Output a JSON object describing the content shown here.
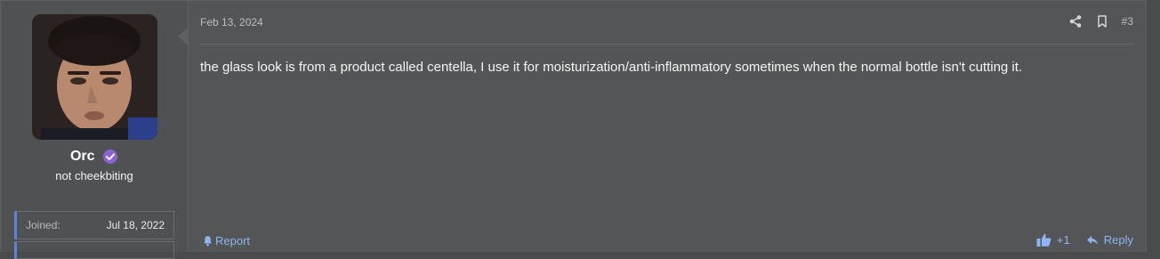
{
  "user": {
    "name": "Orc",
    "title": "not cheekbiting",
    "stats": [
      {
        "label": "Joined:",
        "value": "Jul 18, 2022"
      }
    ]
  },
  "post": {
    "date": "Feb 13, 2024",
    "number": "#3",
    "content": "the glass look is from a product called centella, I use it for moisturization/anti-inflammatory sometimes when the normal bottle isn't cutting it.",
    "report_label": "Report",
    "reaction_label": "+1",
    "reply_label": "Reply"
  },
  "colors": {
    "link": "#8fb4f0",
    "verified": "#8a63d2",
    "accent": "#5c84d6"
  },
  "icons": [
    "share-icon",
    "bookmark-icon",
    "verified-icon",
    "bell-icon",
    "thumbs-up-icon",
    "reply-icon"
  ]
}
